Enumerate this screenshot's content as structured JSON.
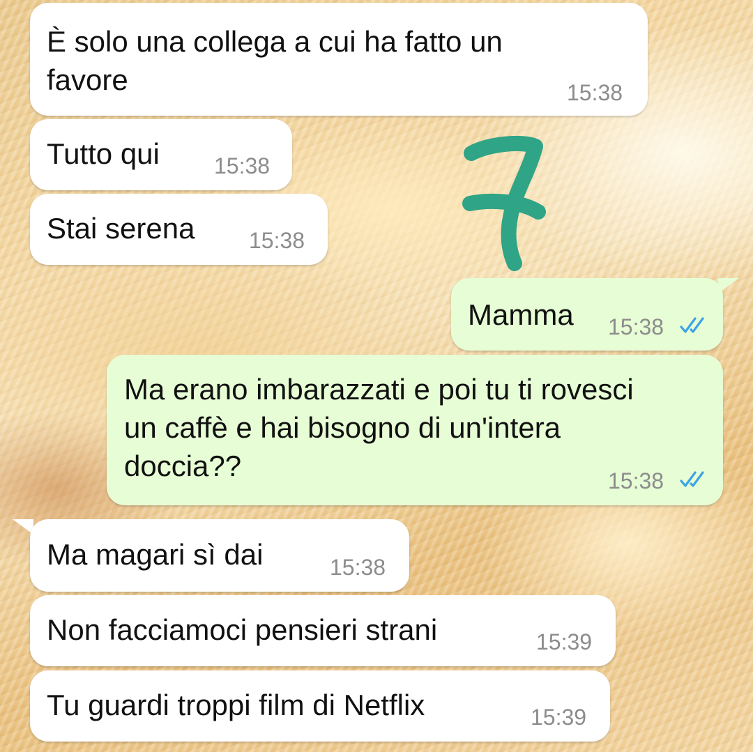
{
  "messages": [
    {
      "direction": "in",
      "text": "È solo una collega a cui ha fatto un\nfavore",
      "time": "15:38"
    },
    {
      "direction": "in",
      "text": "Tutto qui",
      "time": "15:38"
    },
    {
      "direction": "in",
      "text": "Stai serena",
      "time": "15:38"
    },
    {
      "direction": "out",
      "text": "Mamma",
      "time": "15:38",
      "status": "read"
    },
    {
      "direction": "out",
      "text": "Ma erano imbarazzati e poi tu ti rovesci\nun caffè e hai bisogno di un'intera\ndoccia??",
      "time": "15:38",
      "status": "read"
    },
    {
      "direction": "in",
      "text": "Ma magari sì dai",
      "time": "15:38"
    },
    {
      "direction": "in",
      "text": "Non facciamoci pensieri strani",
      "time": "15:39"
    },
    {
      "direction": "in",
      "text": "Tu guardi troppi film di Netflix",
      "time": "15:39"
    }
  ],
  "annotation": {
    "glyph": "7",
    "color": "#2fa486"
  },
  "colors": {
    "incoming_bubble": "#ffffff",
    "outgoing_bubble": "#e7fdd5",
    "read_ticks": "#3ba3e6",
    "timestamp": "#8c8c8c"
  }
}
